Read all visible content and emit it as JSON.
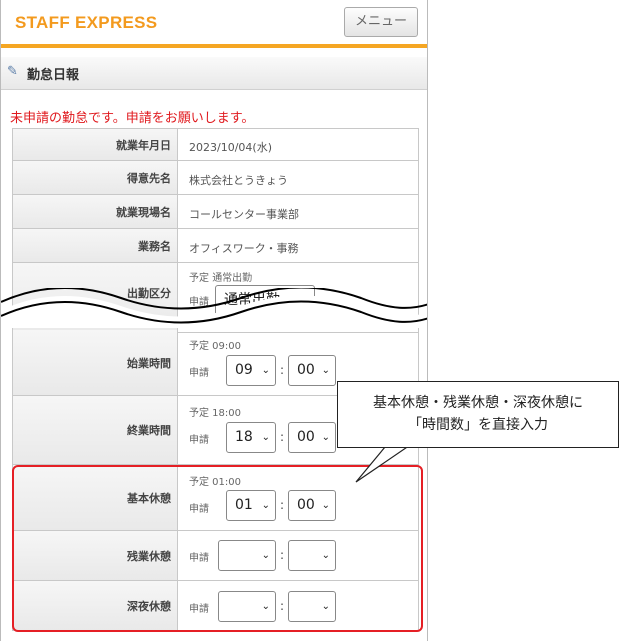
{
  "header": {
    "brand": "STAFF EXPRESS",
    "menu_label": "メニュー"
  },
  "section": {
    "title": "勤怠日報",
    "icon": "form-icon"
  },
  "notice": "未申請の勤怠です。申請をお願いします。",
  "rows": {
    "date": {
      "label": "就業年月日",
      "value": "2023/10/04(水)"
    },
    "client": {
      "label": "得意先名",
      "value": "株式会社とうきょう"
    },
    "site": {
      "label": "就業現場名",
      "value": "コールセンター事業部"
    },
    "job": {
      "label": "業務名",
      "value": "オフィスワーク・事務"
    },
    "attendance": {
      "label": "出勤区分",
      "plan_prefix": "予定",
      "plan": "通常出勤",
      "apply_prefix": "申請",
      "apply": "通常出勤"
    },
    "start": {
      "label": "始業時間",
      "plan": "予定 09:00",
      "apply_prefix": "申請",
      "hour": "09",
      "minute": "00"
    },
    "end": {
      "label": "終業時間",
      "plan": "予定 18:00",
      "apply_prefix": "申請",
      "hour": "18",
      "minute": "00"
    },
    "basic_break": {
      "label": "基本休憩",
      "plan": "予定 01:00",
      "apply_prefix": "申請",
      "hour": "01",
      "minute": "00"
    },
    "overtime_break": {
      "label": "残業休憩",
      "apply_prefix": "申請",
      "hour": "",
      "minute": ""
    },
    "night_break": {
      "label": "深夜休憩",
      "apply_prefix": "申請",
      "hour": "",
      "minute": ""
    }
  },
  "callout": {
    "line1": "基本休憩・残業休憩・深夜休憩に",
    "line2": "「時間数」を直接入力"
  },
  "colors": {
    "brand": "#f39a1e",
    "accent_bar": "#f5a623",
    "notice": "#e0191e",
    "highlight": "#e51f25"
  }
}
